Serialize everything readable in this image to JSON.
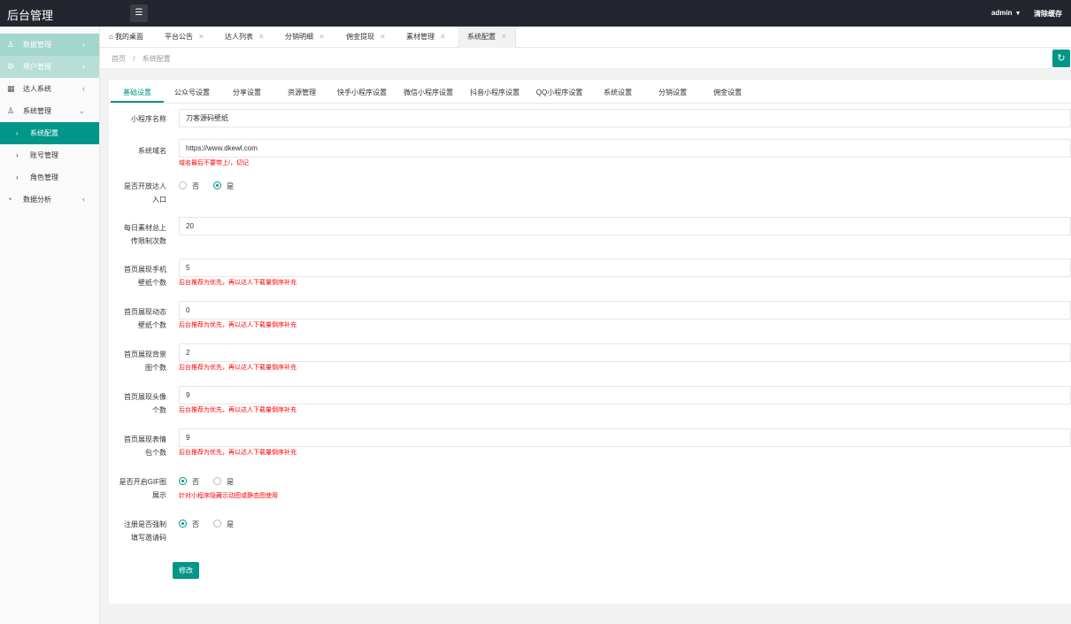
{
  "topbar": {
    "title": "后台管理",
    "user": "admin",
    "clear_cache": "清除缓存"
  },
  "sidebar": {
    "items": [
      {
        "label": "数据管理",
        "icon": "user-icon"
      },
      {
        "label": "用户管理",
        "icon": "gear-icon"
      },
      {
        "label": "达人系统",
        "icon": "grid-icon"
      },
      {
        "label": "系统管理",
        "icon": "user-icon"
      },
      {
        "label": "数据分析",
        "icon": "chart-icon"
      }
    ],
    "subs": [
      "系统配置",
      "账号管理",
      "角色管理"
    ]
  },
  "tabs": [
    "我的桌面",
    "平台公告",
    "达人列表",
    "分销明细",
    "佣金提现",
    "素材管理",
    "系统配置"
  ],
  "breadcrumb": {
    "home": "首页",
    "sep": "/",
    "current": "系统配置"
  },
  "settings_tabs": [
    "基础设置",
    "公众号设置",
    "分享设置",
    "资源管理",
    "快手小程序设置",
    "微信小程序设置",
    "抖音小程序设置",
    "QQ小程序设置",
    "系统设置",
    "分销设置",
    "佣金设置"
  ],
  "form": {
    "app_name": {
      "label": "小程序名称",
      "value": "刀客源码壁纸"
    },
    "domain": {
      "label": "系统域名",
      "value": "https://www.dkewl.com",
      "hint": "域名最后不要带上/，切记"
    },
    "open_entry": {
      "label1": "是否开放达人",
      "label2": "入口",
      "no": "否",
      "yes": "是"
    },
    "daily_limit": {
      "label1": "每日素材总上",
      "label2": "传限制次数",
      "value": "20"
    },
    "phone_wall": {
      "label1": "首页展现手机",
      "label2": "壁纸个数",
      "value": "5",
      "hint": "后台推荐为优先，再以达人下载量倒序补充"
    },
    "dynamic_wall": {
      "label1": "首页展现动态",
      "label2": "壁纸个数",
      "value": "0",
      "hint": "后台推荐为优先，再以达人下载量倒序补充"
    },
    "bg_img": {
      "label1": "首页展现背景",
      "label2": "图个数",
      "value": "2",
      "hint": "后台推荐为优先，再以达人下载量倒序补充"
    },
    "avatar": {
      "label1": "首页展现头像",
      "label2": "个数",
      "value": "9",
      "hint": "后台推荐为优先，再以达人下载量倒序补充"
    },
    "emoji": {
      "label1": "首页展现表情",
      "label2": "包个数",
      "value": "9",
      "hint": "后台推荐为优先，再以达人下载量倒序补充"
    },
    "gif": {
      "label1": "是否开启GIF图",
      "label2": "展示",
      "no": "否",
      "yes": "是",
      "hint": "针对小程序隐藏示动图或静态图使用"
    },
    "invite": {
      "label1": "注册是否强制",
      "label2": "填写邀请码",
      "no": "否",
      "yes": "是"
    },
    "submit": "修改"
  }
}
